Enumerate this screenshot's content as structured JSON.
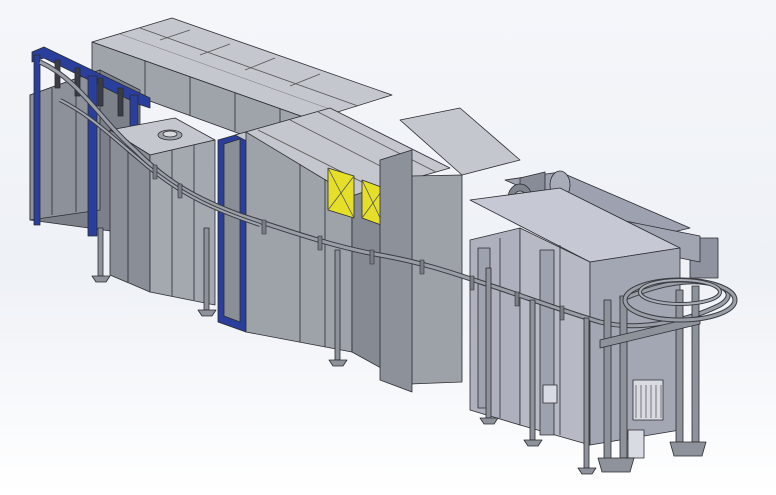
{
  "scene": {
    "subject": "",
    "colors": {
      "background_top": "#f4f6fa",
      "background_bottom": "#ffffff",
      "panel_light": "#a9acb3",
      "panel_mid": "#8f939b",
      "panel_dark": "#6e727a",
      "roof": "#c4c7cd",
      "edge": "#2a2c31",
      "frame_blue": "#2a3e9c",
      "window_yellow": "#e6df2a",
      "conveyor": "#9a9ea6"
    }
  }
}
